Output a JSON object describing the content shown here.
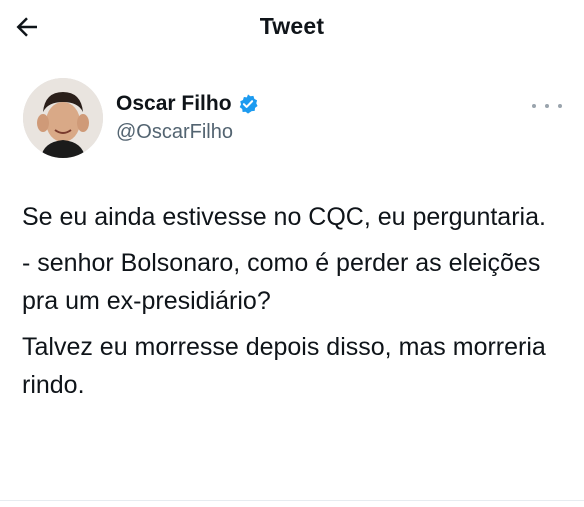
{
  "header": {
    "title": "Tweet",
    "back_icon": "arrow-left-icon"
  },
  "author": {
    "display_name": "Oscar Filho",
    "handle": "@OscarFilho",
    "verified_icon": "verified-badge-icon",
    "verified_color": "#1d9bf0"
  },
  "tweet": {
    "paragraphs": [
      "Se eu ainda estivesse no CQC, eu perguntaria.",
      "- senhor Bolsonaro, como é perder as eleições pra um ex-presidiário?",
      "Talvez eu morresse depois disso, mas morreria rindo."
    ]
  },
  "more_icon": "more-horizontal-icon"
}
